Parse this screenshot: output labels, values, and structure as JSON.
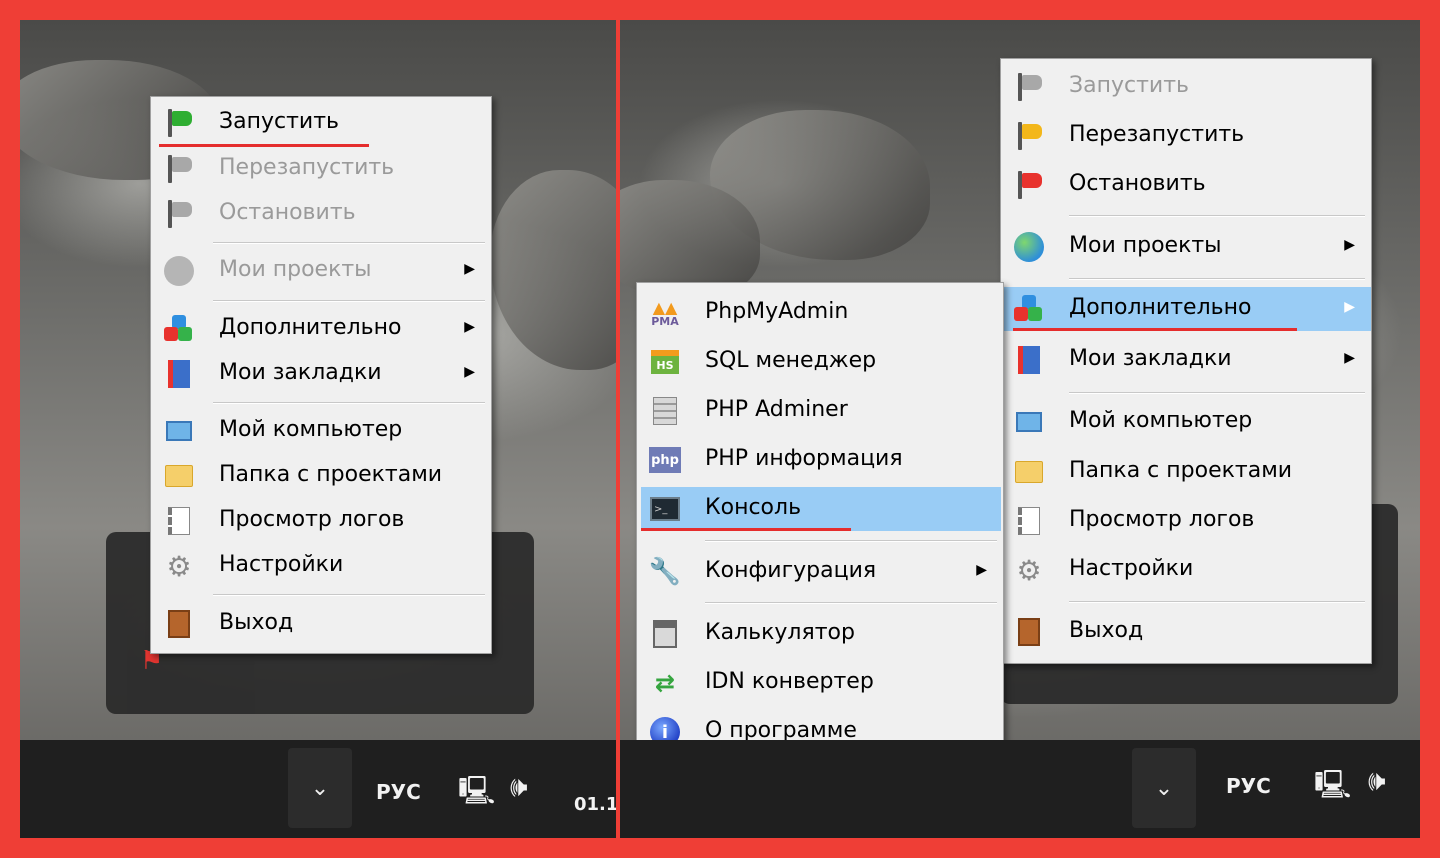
{
  "left_menu": {
    "items": [
      {
        "label": "Запустить",
        "disabled": false,
        "icon": "green-flag-icon"
      },
      {
        "label": "Перезапустить",
        "disabled": true,
        "icon": "grey-flag-icon"
      },
      {
        "label": "Остановить",
        "disabled": true,
        "icon": "grey-flag-icon"
      },
      {
        "label": "Мои проекты",
        "disabled": true,
        "icon": "grey-circle-icon",
        "submenu": true
      },
      {
        "label": "Дополнительно",
        "disabled": false,
        "icon": "blocks-icon",
        "submenu": true
      },
      {
        "label": "Мои закладки",
        "disabled": false,
        "icon": "bookmarks-icon",
        "submenu": true
      },
      {
        "label": "Мой компьютер",
        "disabled": false,
        "icon": "computer-icon"
      },
      {
        "label": "Папка с проектами",
        "disabled": false,
        "icon": "folder-icon"
      },
      {
        "label": "Просмотр логов",
        "disabled": false,
        "icon": "log-icon"
      },
      {
        "label": "Настройки",
        "disabled": false,
        "icon": "gear-icon"
      },
      {
        "label": "Выход",
        "disabled": false,
        "icon": "exit-door-icon"
      }
    ]
  },
  "right_menu": {
    "items": [
      {
        "label": "Запустить",
        "disabled": true,
        "icon": "grey-flag-icon"
      },
      {
        "label": "Перезапустить",
        "disabled": false,
        "icon": "yellow-flag-icon"
      },
      {
        "label": "Остановить",
        "disabled": false,
        "icon": "red-flag-icon"
      },
      {
        "label": "Мои проекты",
        "disabled": false,
        "icon": "globe-icon",
        "submenu": true
      },
      {
        "label": "Дополнительно",
        "disabled": false,
        "icon": "blocks-icon",
        "submenu": true,
        "highlighted": true
      },
      {
        "label": "Мои закладки",
        "disabled": false,
        "icon": "bookmarks-icon",
        "submenu": true
      },
      {
        "label": "Мой компьютер",
        "disabled": false,
        "icon": "computer-icon"
      },
      {
        "label": "Папка с проектами",
        "disabled": false,
        "icon": "folder-icon"
      },
      {
        "label": "Просмотр логов",
        "disabled": false,
        "icon": "log-icon"
      },
      {
        "label": "Настройки",
        "disabled": false,
        "icon": "gear-icon"
      },
      {
        "label": "Выход",
        "disabled": false,
        "icon": "exit-door-icon"
      }
    ]
  },
  "submenu": {
    "items": [
      {
        "label": "PhpMyAdmin",
        "icon": "phpmyadmin-icon"
      },
      {
        "label": "SQL менеджер",
        "icon": "sql-manager-icon"
      },
      {
        "label": "PHP Adminer",
        "icon": "adminer-icon"
      },
      {
        "label": "PHP информация",
        "icon": "php-icon"
      },
      {
        "label": "Консоль",
        "icon": "console-icon",
        "highlighted": true
      },
      {
        "label": "Конфигурация",
        "icon": "wrench-icon",
        "submenu": true
      },
      {
        "label": "Калькулятор",
        "icon": "calculator-icon"
      },
      {
        "label": "IDN конвертер",
        "icon": "idn-converter-icon"
      },
      {
        "label": "О программе",
        "icon": "info-icon"
      }
    ]
  },
  "taskbar": {
    "language": "РУС",
    "chevron": "⌄",
    "clock_partial": "01.1"
  },
  "colors": {
    "frame": "#ef3e36",
    "highlight": "#99ccf5",
    "underline": "#e52d2d"
  }
}
